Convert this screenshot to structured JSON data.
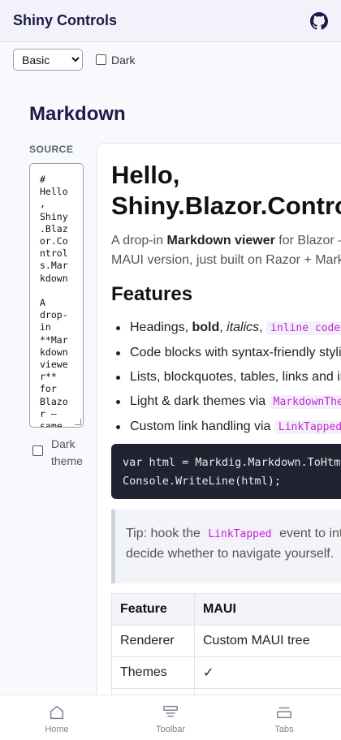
{
  "app": {
    "title": "Shiny Controls"
  },
  "controls": {
    "theme_selected": "Basic",
    "dark_label": "Dark"
  },
  "section": {
    "title": "Markdown"
  },
  "source": {
    "label": "SOURCE",
    "text": "#\nHello\n,\nShiny\n.Blaz\nor.Co\nntrol\ns.Mar\nkdown\n\nA\ndrop-\nin\n**Mar\nkdown\nviewe\nr**\nfor\nBlazo\nr —\nsame"
  },
  "dark_theme": {
    "label_line1": "Dark",
    "label_line2": "theme"
  },
  "preview": {
    "h1_line1": "Hello,",
    "h1_line2": "Shiny.Blazor.Controls.Markdown",
    "intro_1": "A drop-in ",
    "intro_bold": "Markdown viewer",
    "intro_2": " for Blazor — same API as the",
    "intro_3": "MAUI version, just built on Razor + Markdig.",
    "features_title": "Features",
    "feature1_a": "Headings, ",
    "feature1_bold": "bold",
    "feature1_b": ", ",
    "feature1_italic": "italics",
    "feature1_c": ", ",
    "feature1_code": "inline code",
    "feature2": "Code blocks with syntax-friendly styling",
    "feature3": "Lists, blockquotes, tables, links and images",
    "feature4_a": "Light & dark themes via ",
    "feature4_code": "MarkdownTheme",
    "feature5_a": "Custom link handling via ",
    "feature5_code": "LinkTapped",
    "code_line1": "var html = Markdig.Markdown.ToHtml(markdown);",
    "code_line2": "Console.WriteLine(html);",
    "tip_a": "Tip: hook the ",
    "tip_code": "LinkTapped",
    "tip_b": " event to intercept links and",
    "tip_line2": "decide whether to navigate yourself.",
    "table_headers": [
      "Feature",
      "MAUI"
    ],
    "table_rows": [
      [
        "Renderer",
        "Custom MAUI tree"
      ],
      [
        "Themes",
        "✓"
      ],
      [
        "",
        ""
      ]
    ]
  },
  "nav": {
    "home": "Home",
    "toolbar": "Toolbar",
    "tabs": "Tabs"
  },
  "colors": {
    "accent": "#1e1b4b",
    "code_pink": "#c026d3",
    "code_bg": "#1f2430"
  }
}
